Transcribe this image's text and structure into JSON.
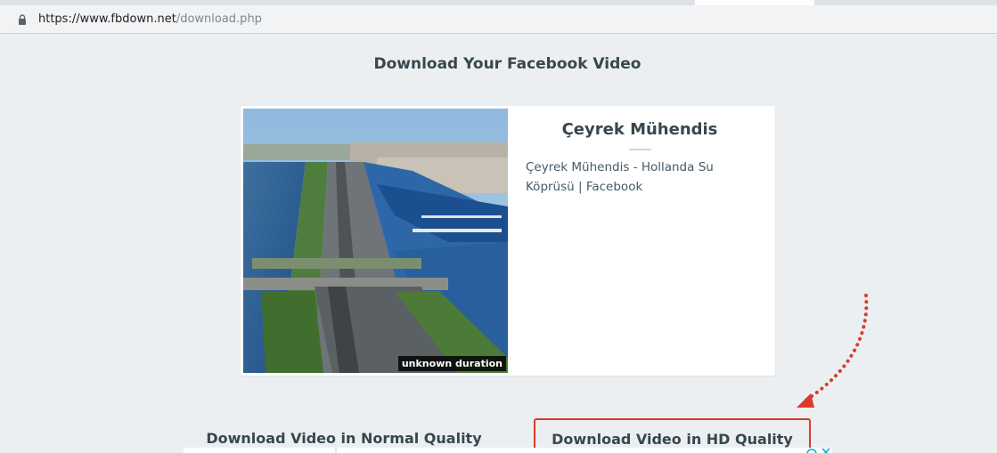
{
  "browser": {
    "url_host": "https://www.fbdown.net",
    "url_path": "/download.php"
  },
  "page": {
    "title": "Download Your Facebook Video"
  },
  "video": {
    "duration": "unknown duration",
    "author": "Çeyrek Mühendis",
    "description": "Çeyrek Mühendis - Hollanda Su Köprüsü | Facebook"
  },
  "buttons": {
    "normal_label": "Download Video in Normal Quality",
    "hd_label": "Download Video in HD Quality"
  },
  "colors": {
    "background": "#eceff1",
    "highlight_red": "#d93a2b",
    "text": "#37474f"
  }
}
